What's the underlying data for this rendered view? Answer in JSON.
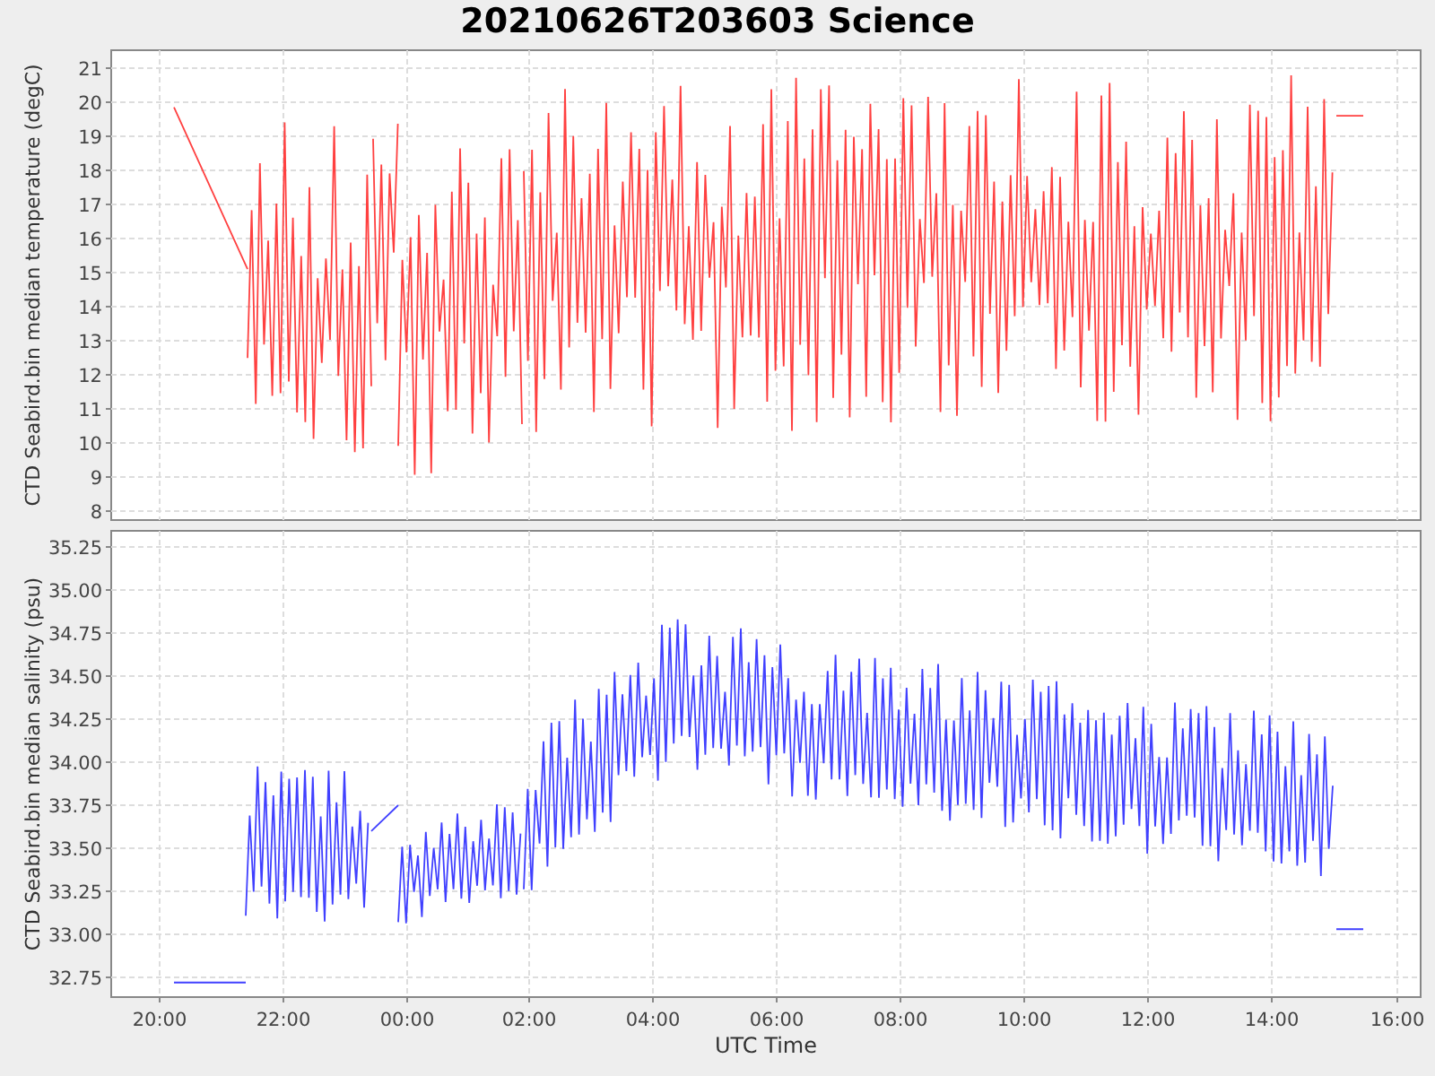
{
  "title": "20210626T203603 Science",
  "plots": [
    {
      "kind": "temperature",
      "ylabel": "CTD Seabird.bin median temperature (degC)",
      "color": "#ff4040",
      "yticks": [
        "21",
        "20",
        "19",
        "18",
        "17",
        "16",
        "15",
        "14",
        "13",
        "12",
        "11",
        "10",
        "9",
        "8"
      ]
    },
    {
      "kind": "salinity",
      "ylabel": "CTD Seabird.bin median salinity (psu)",
      "color": "#4040ff",
      "yticks": [
        "35.25",
        "35.00",
        "34.75",
        "34.50",
        "34.25",
        "34.00",
        "33.75",
        "33.50",
        "33.25",
        "33.00",
        "32.75"
      ]
    }
  ],
  "x_axis": {
    "label": "UTC Time",
    "ticks": [
      "20:00",
      "22:00",
      "00:00",
      "02:00",
      "04:00",
      "06:00",
      "08:00",
      "10:00",
      "12:00",
      "14:00",
      "16:00"
    ]
  }
}
